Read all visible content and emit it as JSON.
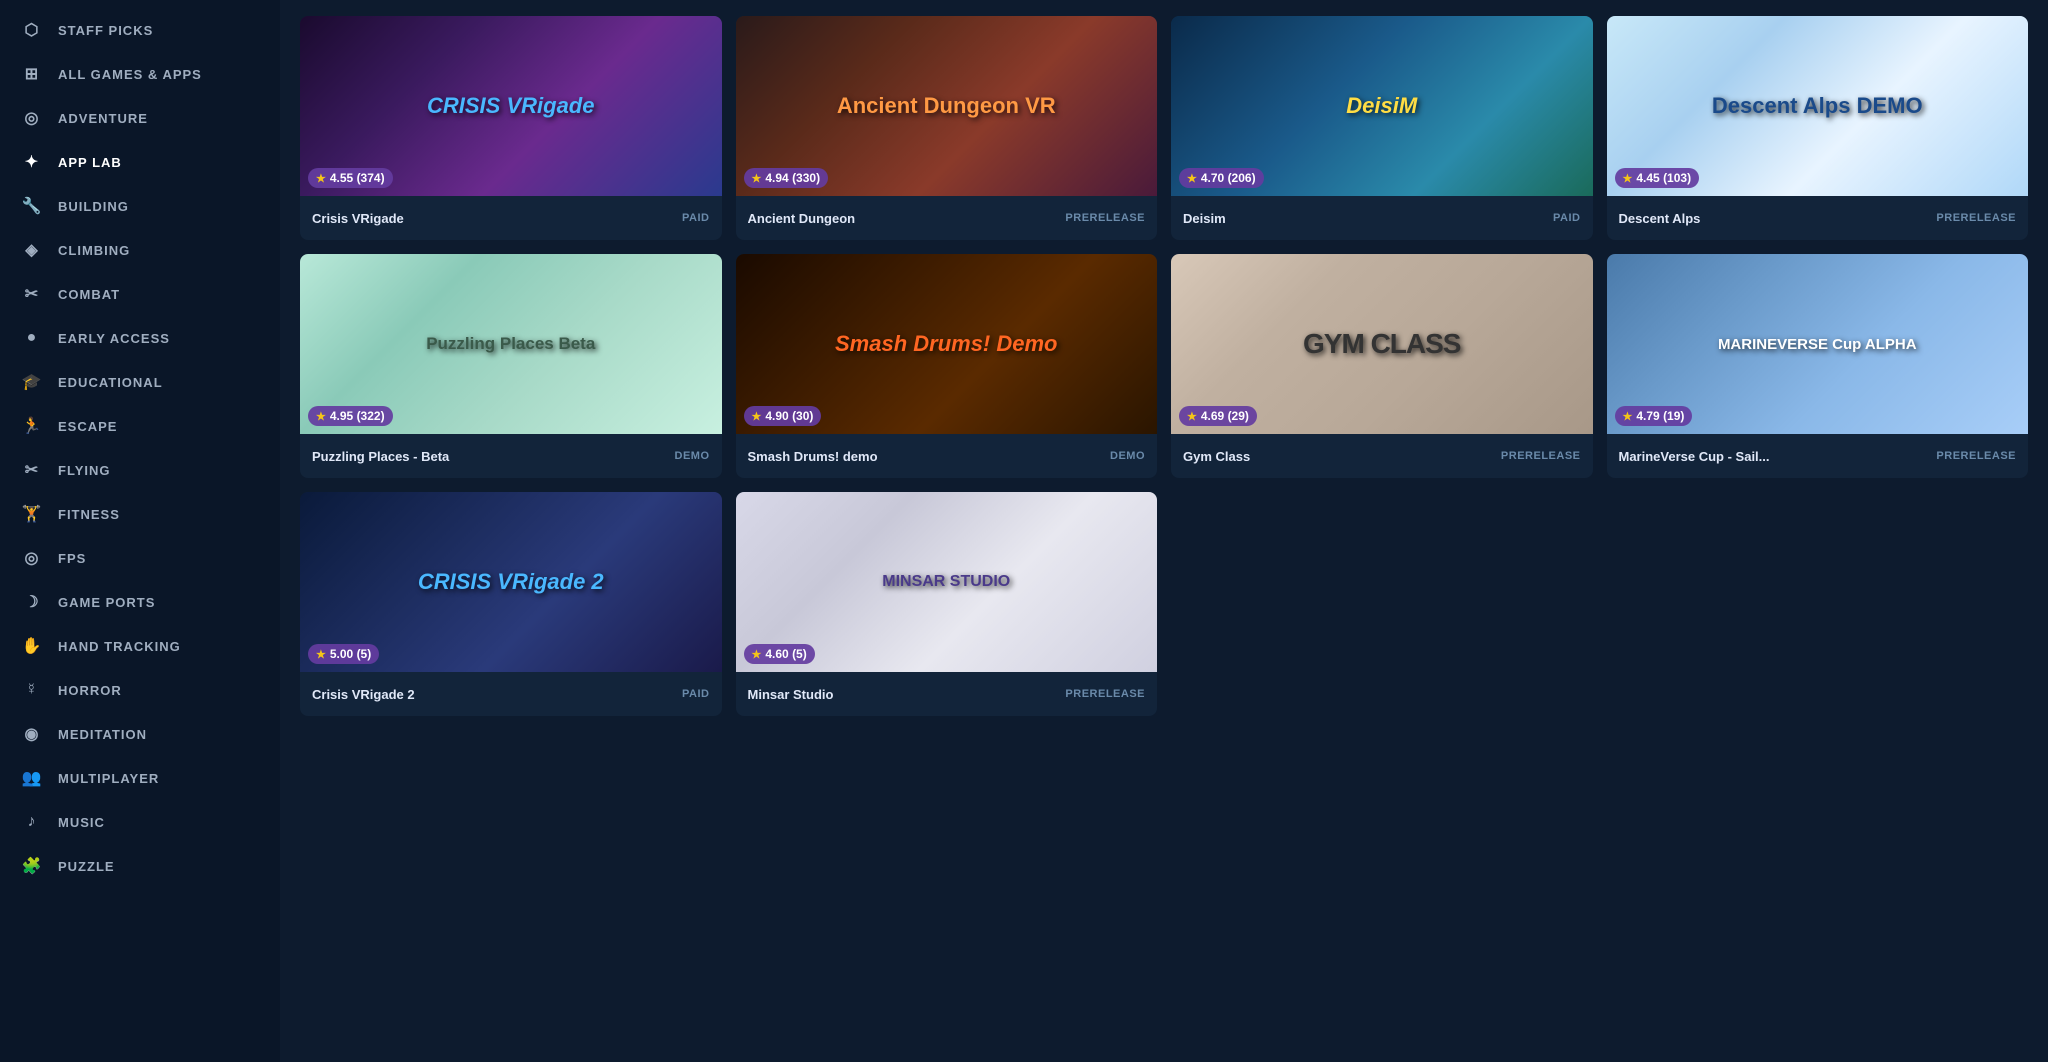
{
  "sidebar": {
    "items": [
      {
        "id": "staff-picks",
        "label": "STAFF PICKS",
        "icon": "⬡",
        "active": false
      },
      {
        "id": "all-games",
        "label": "ALL GAMES & APPS",
        "icon": "⊞",
        "active": false
      },
      {
        "id": "adventure",
        "label": "ADVENTURE",
        "icon": "◎",
        "active": false
      },
      {
        "id": "app-lab",
        "label": "APP LAB",
        "icon": "✦",
        "active": true
      },
      {
        "id": "building",
        "label": "BUILDING",
        "icon": "🔧",
        "active": false
      },
      {
        "id": "climbing",
        "label": "CLIMBING",
        "icon": "◈",
        "active": false
      },
      {
        "id": "combat",
        "label": "COMBAT",
        "icon": "✂",
        "active": false
      },
      {
        "id": "early-access",
        "label": "EARLY ACCESS",
        "icon": "●",
        "active": false
      },
      {
        "id": "educational",
        "label": "EDUCATIONAL",
        "icon": "🎓",
        "active": false
      },
      {
        "id": "escape",
        "label": "ESCAPE",
        "icon": "🏃",
        "active": false
      },
      {
        "id": "flying",
        "label": "FLYING",
        "icon": "✂",
        "active": false
      },
      {
        "id": "fitness",
        "label": "FITNESS",
        "icon": "🏋",
        "active": false
      },
      {
        "id": "fps",
        "label": "FPS",
        "icon": "◎",
        "active": false
      },
      {
        "id": "game-ports",
        "label": "GAME PORTS",
        "icon": "☽",
        "active": false
      },
      {
        "id": "hand-tracking",
        "label": "HAND TRACKING",
        "icon": "✋",
        "active": false
      },
      {
        "id": "horror",
        "label": "HORROR",
        "icon": "☿",
        "active": false
      },
      {
        "id": "meditation",
        "label": "MEDITATION",
        "icon": "◉",
        "active": false
      },
      {
        "id": "multiplayer",
        "label": "MULTIPLAYER",
        "icon": "👥",
        "active": false
      },
      {
        "id": "music",
        "label": "MUSIC",
        "icon": "♪",
        "active": false
      },
      {
        "id": "puzzle",
        "label": "PUZZLE",
        "icon": "🧩",
        "active": false
      }
    ]
  },
  "games": [
    {
      "id": "crisis-vrigade",
      "title": "Crisis VRigade",
      "rating": "4.55",
      "reviews": "374",
      "tag": "PAID",
      "thumb_class": "thumb-crisis-vrigade",
      "thumb_text": "CRISIS VRigade"
    },
    {
      "id": "ancient-dungeon",
      "title": "Ancient Dungeon",
      "rating": "4.94",
      "reviews": "330",
      "tag": "PRERELEASE",
      "thumb_class": "thumb-ancient-dungeon",
      "thumb_text": "Ancient Dungeon VR"
    },
    {
      "id": "deisim",
      "title": "Deisim",
      "rating": "4.70",
      "reviews": "206",
      "tag": "PAID",
      "thumb_class": "thumb-deisim",
      "thumb_text": "DeisiM"
    },
    {
      "id": "descent-alps",
      "title": "Descent Alps",
      "rating": "4.45",
      "reviews": "103",
      "tag": "PRERELEASE",
      "thumb_class": "thumb-descent-alps",
      "thumb_text": "Descent Alps DEMO"
    },
    {
      "id": "puzzling-places",
      "title": "Puzzling Places - Beta",
      "rating": "4.95",
      "reviews": "322",
      "tag": "DEMO",
      "thumb_class": "thumb-puzzling-places",
      "thumb_text": "Puzzling Places Beta"
    },
    {
      "id": "smash-drums",
      "title": "Smash Drums! demo",
      "rating": "4.90",
      "reviews": "30",
      "tag": "DEMO",
      "thumb_class": "thumb-smash-drums",
      "thumb_text": "Smash Drums! Demo"
    },
    {
      "id": "gym-class",
      "title": "Gym Class",
      "rating": "4.69",
      "reviews": "29",
      "tag": "PRERELEASE",
      "thumb_class": "thumb-gym-class",
      "thumb_text": "GYM CLASS"
    },
    {
      "id": "marineverse",
      "title": "MarineVerse Cup - Sail...",
      "rating": "4.79",
      "reviews": "19",
      "tag": "PRERELEASE",
      "thumb_class": "thumb-marineverse",
      "thumb_text": "MARINEVERSE Cup ALPHA"
    },
    {
      "id": "crisis-vrigade-2",
      "title": "Crisis VRigade 2",
      "rating": "5.00",
      "reviews": "5",
      "tag": "PAID",
      "thumb_class": "thumb-crisis-vrigade-2",
      "thumb_text": "CRISIS VRigade 2"
    },
    {
      "id": "minsar",
      "title": "Minsar Studio",
      "rating": "4.60",
      "reviews": "5",
      "tag": "PRERELEASE",
      "thumb_class": "thumb-minsar",
      "thumb_text": "MINSAR STUDIO"
    }
  ]
}
